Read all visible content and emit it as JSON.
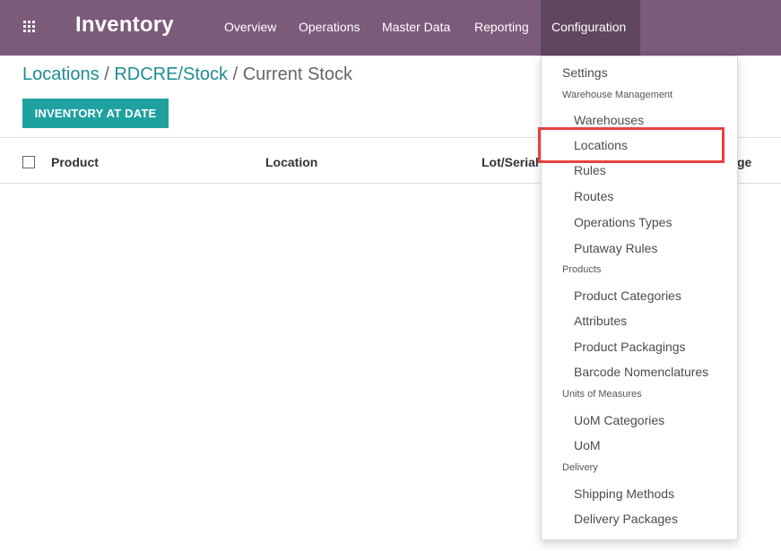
{
  "navbar": {
    "brand": "Inventory",
    "menu": [
      "Overview",
      "Operations",
      "Master Data",
      "Reporting",
      "Configuration"
    ],
    "active": "Configuration",
    "bg_color": "#7c5a7a"
  },
  "breadcrumb": {
    "items": [
      "Locations",
      "RDCRE/Stock"
    ],
    "separator": "/",
    "current": "Current Stock"
  },
  "toolbar": {
    "inventory_at_date": "INVENTORY AT DATE",
    "button_color": "#1fa1a0"
  },
  "table": {
    "columns": [
      "Product",
      "Location",
      "Lot/Serial",
      "ge"
    ]
  },
  "dropdown": {
    "settings": "Settings",
    "sections": [
      {
        "header": "Warehouse Management",
        "items": [
          "Warehouses",
          "Locations",
          "Rules",
          "Routes",
          "Operations Types",
          "Putaway Rules"
        ]
      },
      {
        "header": "Products",
        "items": [
          "Product Categories",
          "Attributes",
          "Product Packagings",
          "Barcode Nomenclatures"
        ]
      },
      {
        "header": "Units of Measures",
        "items": [
          "UoM Categories",
          "UoM"
        ]
      },
      {
        "header": "Delivery",
        "items": [
          "Shipping Methods",
          "Delivery Packages"
        ]
      }
    ],
    "highlighted": "Locations",
    "highlight_color": "#e84040"
  }
}
